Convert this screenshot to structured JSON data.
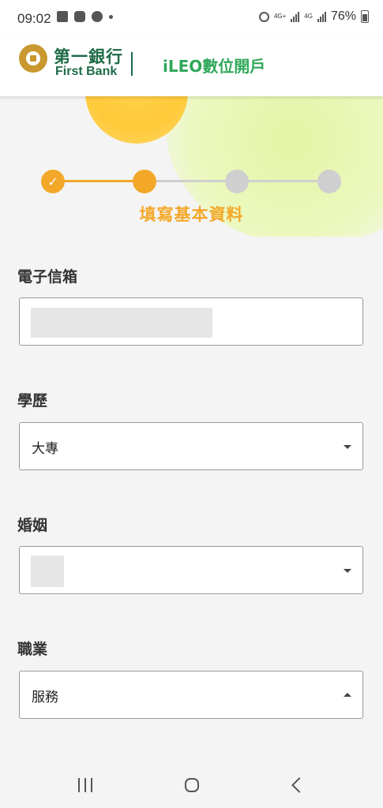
{
  "status_bar": {
    "time": "09:02",
    "network_1": "4G+",
    "network_2": "4G",
    "battery": "76%"
  },
  "header": {
    "bank_name_zh": "第一銀行",
    "bank_name_en": "First Bank",
    "product": "iLEO數位開戶"
  },
  "stepper": {
    "current_step_title": "填寫基本資料",
    "steps": [
      {
        "state": "done"
      },
      {
        "state": "active"
      },
      {
        "state": "todo"
      },
      {
        "state": "todo"
      }
    ],
    "colors": {
      "active": "#f3a829",
      "inactive": "#cfcfcf"
    }
  },
  "form": {
    "email": {
      "label": "電子信箱",
      "value": ""
    },
    "education": {
      "label": "學歷",
      "value": "大專"
    },
    "marital": {
      "label": "婚姻",
      "value": ""
    },
    "occupation": {
      "label": "職業",
      "value": "服務"
    }
  }
}
